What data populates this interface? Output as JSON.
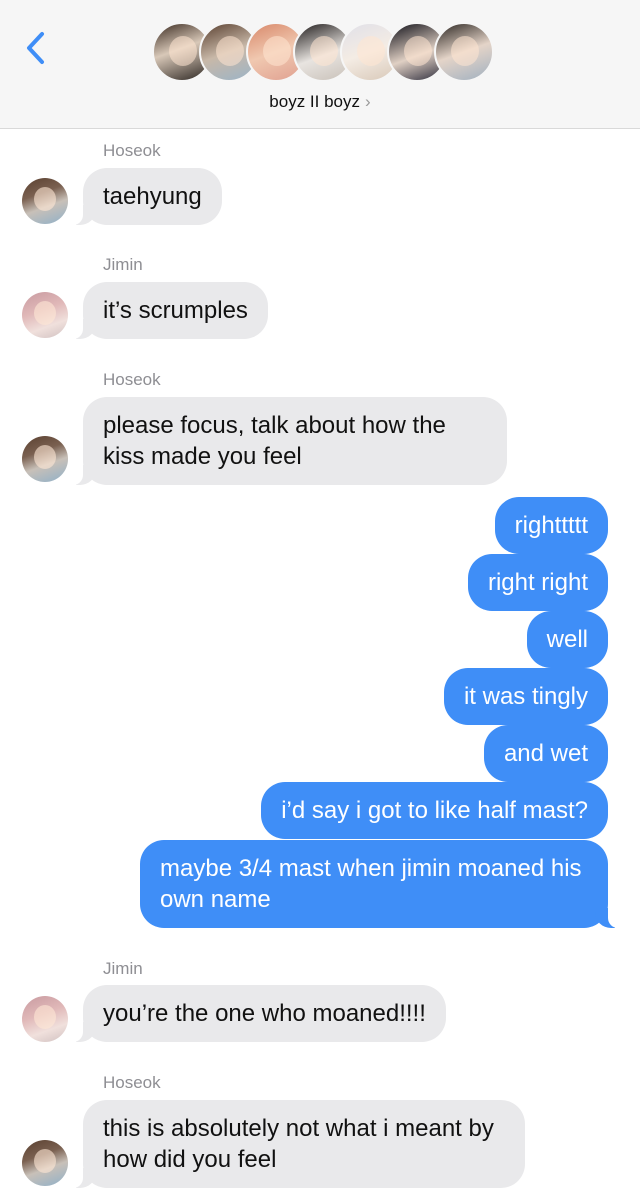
{
  "header": {
    "group_name": "boyz II boyz",
    "chevron": "›",
    "back_icon": "chevron-left-icon",
    "accent_color": "#3f8ef7",
    "avatar_count": 7
  },
  "messages": [
    {
      "sender": "Hoseok",
      "text": "taehyung"
    },
    {
      "sender": "Jimin",
      "text": "it’s scrumples"
    },
    {
      "sender": "Hoseok",
      "text": "please focus, talk about how the kiss made you feel"
    },
    {
      "text": "righttttt"
    },
    {
      "text": "right right"
    },
    {
      "text": "well"
    },
    {
      "text": "it was tingly"
    },
    {
      "text": "and wet"
    },
    {
      "text": "i’d say i got to like half mast?"
    },
    {
      "text": "maybe 3/4 mast when jimin moaned his own name"
    },
    {
      "sender": "Jimin",
      "text": "you’re the one who moaned!!!!"
    },
    {
      "sender": "Hoseok",
      "text": "this is absolutely not what i meant by how did you feel"
    }
  ],
  "colors": {
    "incoming_bubble": "#e9e9eb",
    "outgoing_bubble": "#3f8ef7",
    "sender_label": "#8e8e93"
  }
}
